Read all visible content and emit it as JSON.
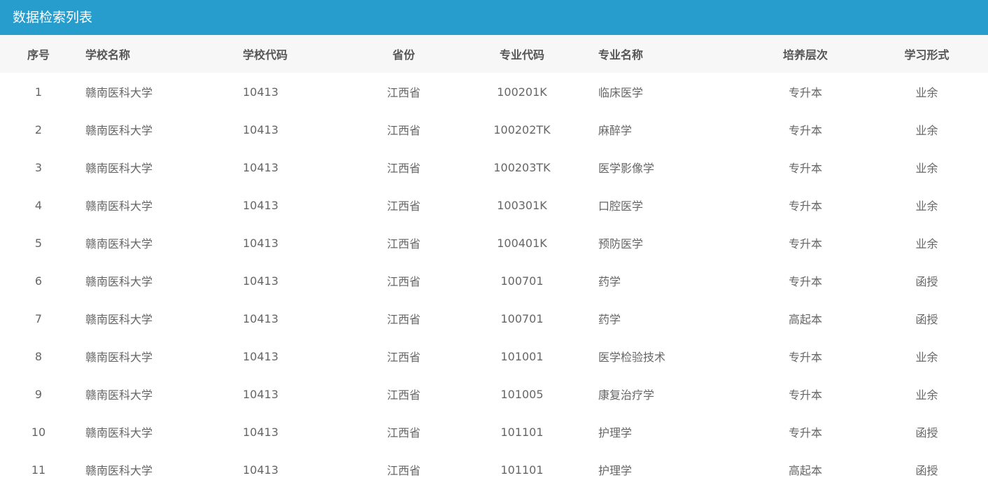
{
  "panel": {
    "title": "数据检索列表"
  },
  "table": {
    "headers": [
      "序号",
      "学校名称",
      "学校代码",
      "省份",
      "专业代码",
      "专业名称",
      "培养层次",
      "学习形式"
    ],
    "rows": [
      [
        "1",
        "赣南医科大学",
        "10413",
        "江西省",
        "100201K",
        "临床医学",
        "专升本",
        "业余"
      ],
      [
        "2",
        "赣南医科大学",
        "10413",
        "江西省",
        "100202TK",
        "麻醉学",
        "专升本",
        "业余"
      ],
      [
        "3",
        "赣南医科大学",
        "10413",
        "江西省",
        "100203TK",
        "医学影像学",
        "专升本",
        "业余"
      ],
      [
        "4",
        "赣南医科大学",
        "10413",
        "江西省",
        "100301K",
        "口腔医学",
        "专升本",
        "业余"
      ],
      [
        "5",
        "赣南医科大学",
        "10413",
        "江西省",
        "100401K",
        "预防医学",
        "专升本",
        "业余"
      ],
      [
        "6",
        "赣南医科大学",
        "10413",
        "江西省",
        "100701",
        "药学",
        "专升本",
        "函授"
      ],
      [
        "7",
        "赣南医科大学",
        "10413",
        "江西省",
        "100701",
        "药学",
        "高起本",
        "函授"
      ],
      [
        "8",
        "赣南医科大学",
        "10413",
        "江西省",
        "101001",
        "医学检验技术",
        "专升本",
        "业余"
      ],
      [
        "9",
        "赣南医科大学",
        "10413",
        "江西省",
        "101005",
        "康复治疗学",
        "专升本",
        "业余"
      ],
      [
        "10",
        "赣南医科大学",
        "10413",
        "江西省",
        "101101",
        "护理学",
        "专升本",
        "函授"
      ],
      [
        "11",
        "赣南医科大学",
        "10413",
        "江西省",
        "101101",
        "护理学",
        "高起本",
        "函授"
      ]
    ]
  },
  "colors": {
    "header_bg": "#279dce",
    "thead_bg": "#f7f7f7",
    "text": "#666666"
  }
}
